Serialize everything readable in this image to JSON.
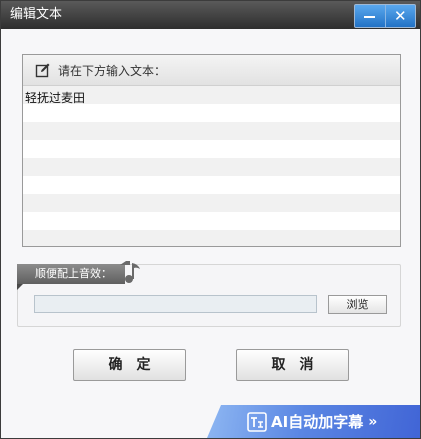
{
  "window": {
    "title": "编辑文本",
    "minimize_icon": "minimize-icon",
    "close_icon": "close-icon",
    "close_symbol": "✕"
  },
  "text_panel": {
    "prompt": "请在下方输入文本：",
    "icon": "edit-icon",
    "content": "轻抚过麦田"
  },
  "music_panel": {
    "tag_label": "顺便配上音效：",
    "icon": "music-note-icon",
    "file_value": "",
    "browse_label": "浏览"
  },
  "buttons": {
    "ok_label": "确定",
    "cancel_label": "取消"
  },
  "ai_bar": {
    "icon": "ai-subtitle-icon",
    "label": "AI自动加字幕",
    "chevron": "»",
    "colors": {
      "start": "#8eb7f2",
      "end": "#4165d6"
    }
  },
  "colors": {
    "titlebar": "#3a3a3a",
    "window_button": "#2f80d4",
    "panel_border": "#9a9a9a"
  }
}
